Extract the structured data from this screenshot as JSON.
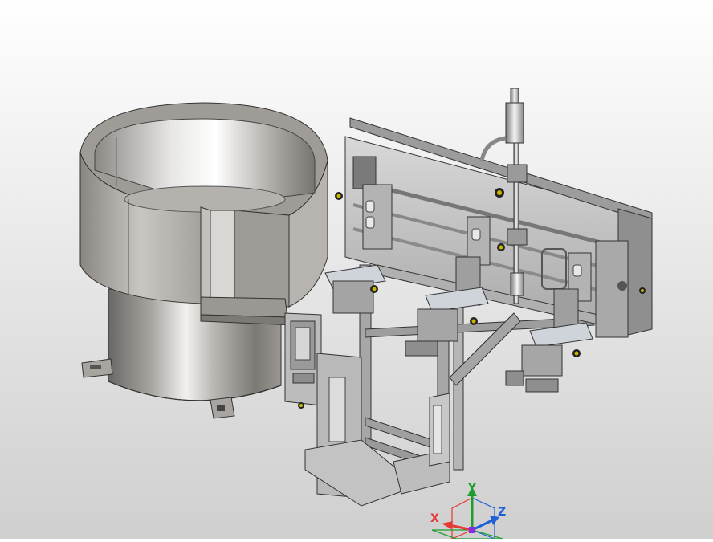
{
  "viewport": {
    "model": "bowl-feeder-assembly",
    "background_top": "#ffffff",
    "background_bottom": "#cfcfcf"
  },
  "triad": {
    "x_label": "X",
    "y_label": "Y",
    "z_label": "Z",
    "x_color": "#e53935",
    "y_color": "#1e9e2e",
    "z_color": "#1e5fd8"
  }
}
